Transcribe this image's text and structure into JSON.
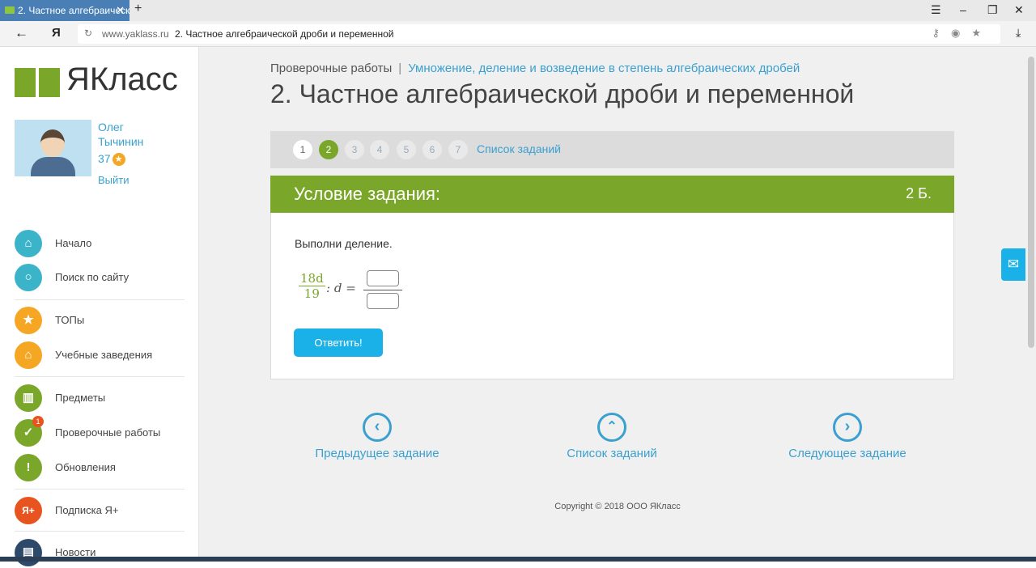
{
  "browser": {
    "tab_title": "2. Частное алгебраическ",
    "host": "www.yaklass.ru",
    "page_title": "2. Частное алгебраической дроби и переменной",
    "yandex_letter": "Я"
  },
  "sidebar": {
    "logo_text": "ЯКласс",
    "user_first": "Олег",
    "user_last": "Тычинин",
    "points": "37",
    "logout": "Выйти",
    "nav": [
      {
        "label": "Начало",
        "icon": "home-icon",
        "color": "#3bb3c9"
      },
      {
        "label": "Поиск по сайту",
        "icon": "search-icon",
        "color": "#3bb3c9"
      },
      {
        "label": "ТОПы",
        "icon": "star-icon",
        "color": "#f5a623"
      },
      {
        "label": "Учебные заведения",
        "icon": "institution-icon",
        "color": "#f5a623"
      },
      {
        "label": "Предметы",
        "icon": "book-icon",
        "color": "#7aa62a"
      },
      {
        "label": "Проверочные работы",
        "icon": "check-icon",
        "color": "#7aa62a",
        "badge": "1"
      },
      {
        "label": "Обновления",
        "icon": "exclamation-icon",
        "color": "#7aa62a"
      },
      {
        "label": "Подписка Я+",
        "icon": "yaplus-icon",
        "color": "#e8541f"
      },
      {
        "label": "Новости",
        "icon": "chat-icon",
        "color": "#2e4a6a"
      }
    ]
  },
  "main": {
    "breadcrumb_1": "Проверочные работы",
    "breadcrumb_sep": "|",
    "breadcrumb_2": "Умножение, деление и возведение в степень алгебраических дробей",
    "title": "2. Частное алгебраической дроби и переменной",
    "pages": [
      "1",
      "2",
      "3",
      "4",
      "5",
      "6",
      "7"
    ],
    "active_page": "2",
    "task_list_link": "Список заданий",
    "task_header": "Условие задания:",
    "task_points": "2 Б.",
    "task_text": "Выполни деление.",
    "math": {
      "numerator": "18d",
      "denominator": "19",
      "rest": ": d ="
    },
    "answer_button": "Ответить!",
    "prev_label": "Предыдущее задание",
    "list_label": "Список заданий",
    "next_label": "Следующее задание",
    "copyright": "Copyright © 2018 ООО ЯКласс"
  }
}
